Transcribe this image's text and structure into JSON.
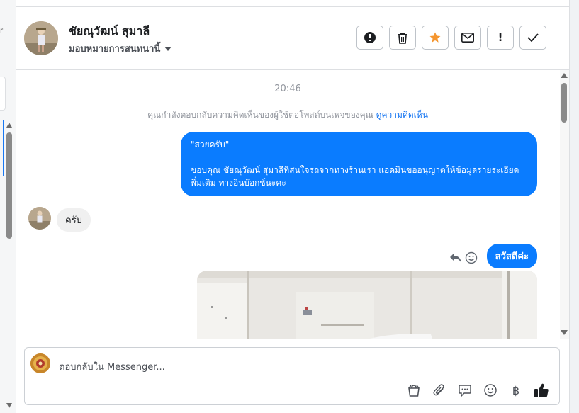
{
  "left_panel": {
    "edge_mark": "r"
  },
  "header": {
    "contact_name": "ชัยณุวัฒน์ สุมาลี",
    "assign_label": "มอบหมายการสนทนานี้",
    "actions": {
      "block_icon": "alert-circle-icon",
      "delete_icon": "trash-icon",
      "star_icon": "star-icon",
      "mail_icon": "envelope-icon",
      "spam_label": "!",
      "done_icon": "check-icon"
    },
    "star_color": "#f5962f"
  },
  "conversation": {
    "timestamp": "20:46",
    "notice_text": "คุณกำลังตอบกลับความคิดเห็นของผู้ใช้ต่อโพสต์บนเพจของคุณ",
    "notice_link": "ดูความคิดเห็น",
    "messages": [
      {
        "direction": "outgoing",
        "quote": "\"สวยครับ\"",
        "text": "ขอบคุณ ชัยณุวัฒน์ สุมาลีที่สนใจรถจากทางร้านเรา แอดมินขออนุญาตให้ข้อมูลรายระเอียดพิ่มเติม ทางอินบ๊อกซ์นะคะ"
      },
      {
        "direction": "incoming",
        "text": "ครับ"
      },
      {
        "direction": "outgoing",
        "text": "สวัสดีค่ะ"
      },
      {
        "direction": "outgoing",
        "type": "photo"
      }
    ]
  },
  "composer": {
    "placeholder": "ตอบกลับใน Messenger...",
    "tools": [
      "bag-icon",
      "paperclip-icon",
      "saved-reply-icon",
      "emoji-icon",
      "baht-icon",
      "like-icon"
    ],
    "baht_symbol": "฿"
  },
  "colors": {
    "messenger_blue": "#0a7cff",
    "link_blue": "#1877f2"
  }
}
